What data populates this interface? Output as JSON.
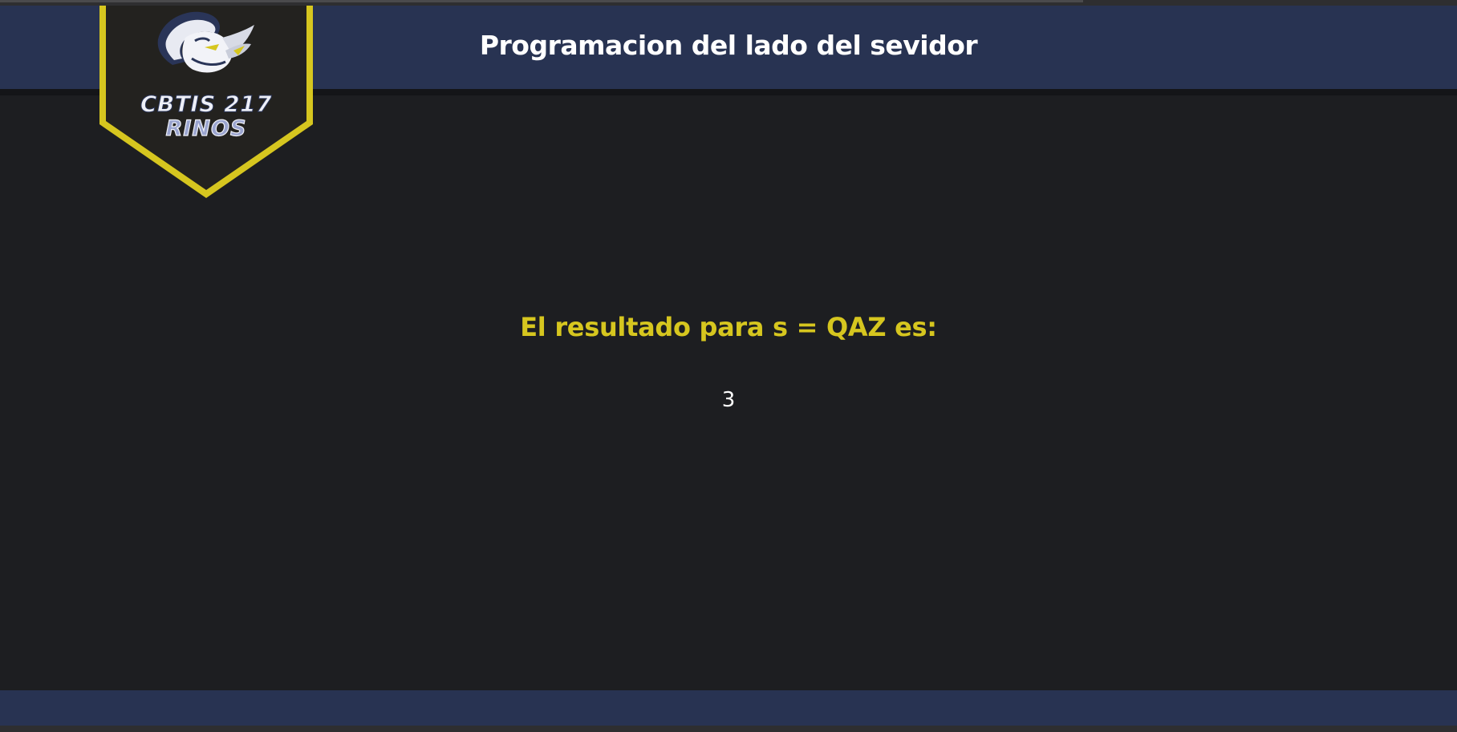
{
  "header": {
    "title": "Programacion del lado del sevidor"
  },
  "logo": {
    "line1": "CBTIS 217",
    "line2": "RINOS",
    "icon": "rhino-mascot-icon"
  },
  "main": {
    "heading": "El resultado para s = QAZ es:",
    "value": "3"
  },
  "colors": {
    "header_bg": "#283352",
    "page_bg": "#1d1e21",
    "accent_yellow": "#d6c61f",
    "badge_bg": "#23221f"
  }
}
